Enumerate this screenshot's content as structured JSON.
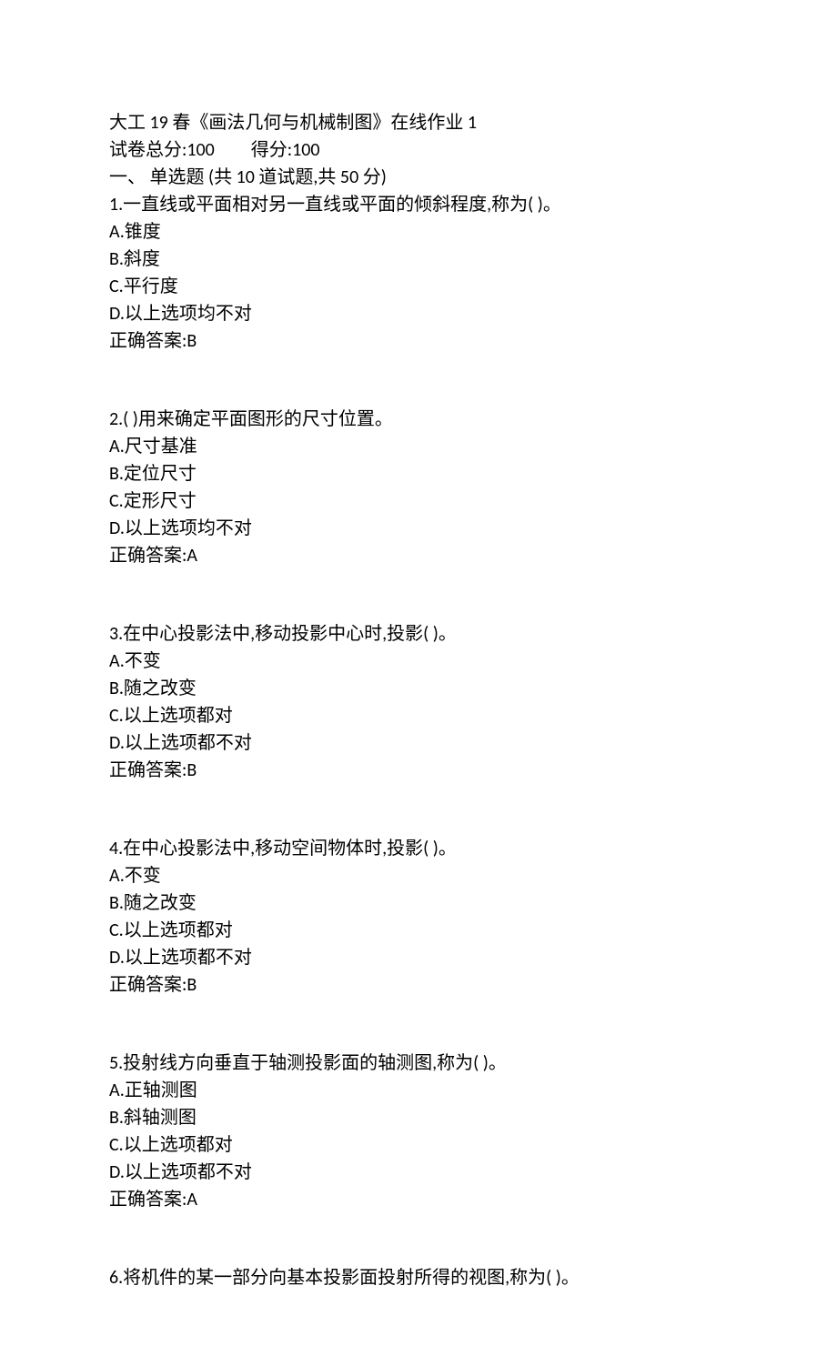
{
  "header": {
    "title": "大工 19 春《画法几何与机械制图》在线作业 1",
    "total_label": "试卷总分:",
    "total_value": "100",
    "score_label": "得分:",
    "score_value": "100"
  },
  "section": {
    "heading": "一、  单选题  (共  10  道试题,共  50  分)"
  },
  "questions": [
    {
      "stem": "1.一直线或平面相对另一直线或平面的倾斜程度,称为( )。",
      "options": [
        "A.锥度",
        "B.斜度",
        "C.平行度",
        "D.以上选项均不对"
      ],
      "answer": "正确答案:B"
    },
    {
      "stem": "2.( )用来确定平面图形的尺寸位置。",
      "options": [
        "A.尺寸基准",
        "B.定位尺寸",
        "C.定形尺寸",
        "D.以上选项均不对"
      ],
      "answer": "正确答案:A"
    },
    {
      "stem": "3.在中心投影法中,移动投影中心时,投影( )。",
      "options": [
        "A.不变",
        "B.随之改变",
        "C.以上选项都对",
        "D.以上选项都不对"
      ],
      "answer": "正确答案:B"
    },
    {
      "stem": "4.在中心投影法中,移动空间物体时,投影( )。",
      "options": [
        "A.不变",
        "B.随之改变",
        "C.以上选项都对",
        "D.以上选项都不对"
      ],
      "answer": "正确答案:B"
    },
    {
      "stem": "5.投射线方向垂直于轴测投影面的轴测图,称为( )。",
      "options": [
        "A.正轴测图",
        "B.斜轴测图",
        "C.以上选项都对",
        "D.以上选项都不对"
      ],
      "answer": "正确答案:A"
    },
    {
      "stem": "6.将机件的某一部分向基本投影面投射所得的视图,称为( )。",
      "options": [],
      "answer": ""
    }
  ]
}
